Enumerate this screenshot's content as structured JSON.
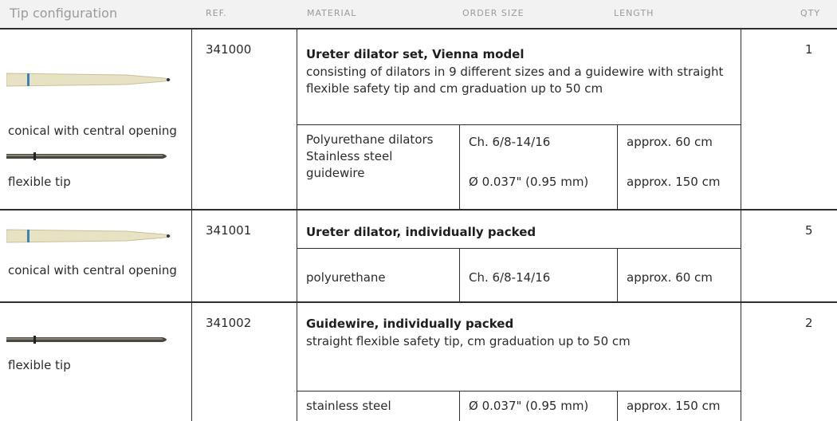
{
  "header": {
    "tip": "Tip configuration",
    "ref": "REF.",
    "material": "MATERIAL",
    "order_size": "ORDER SIZE",
    "length": "LENGTH",
    "qty": "QTY"
  },
  "rows": [
    {
      "ref": "341000",
      "title": "Ureter dilator set, Vienna model",
      "desc": "consisting of dilators in 9 different sizes and a guidewire with straight flexible safety tip and cm graduation up to 50 cm",
      "qty": "1",
      "tips": [
        "conical with central opening",
        "flexible tip"
      ],
      "material_a": "Polyurethane dilators",
      "material_b": "Stainless steel guidewire",
      "size_a": "Ch. 6/8-14/16",
      "size_b": "Ø 0.037\" (0.95 mm)",
      "length_a": "approx. 60 cm",
      "length_b": "approx. 150 cm"
    },
    {
      "ref": "341001",
      "title": "Ureter dilator, individually packed",
      "qty": "5",
      "tips": [
        "conical with central opening"
      ],
      "material": "polyurethane",
      "size": "Ch. 6/8-14/16",
      "length": "approx. 60 cm"
    },
    {
      "ref": "341002",
      "title": "Guidewire, individually packed",
      "desc": "straight flexible safety tip, cm graduation up to 50 cm",
      "qty": "2",
      "tips": [
        "flexible tip"
      ],
      "material": "stainless steel",
      "size": "Ø 0.037\" (0.95 mm)",
      "length": "approx. 150 cm"
    }
  ],
  "tool_icons": [
    "conical-dilator-tip-image",
    "flexible-guidewire-tip-image"
  ],
  "colors": {
    "header_bg": "#f2f2f3",
    "header_text": "#9a9a9f",
    "rule": "#2e2e2e",
    "dilator": "#e8e2c4",
    "stripe": "#3b82b8",
    "wire": "#4a4640"
  }
}
